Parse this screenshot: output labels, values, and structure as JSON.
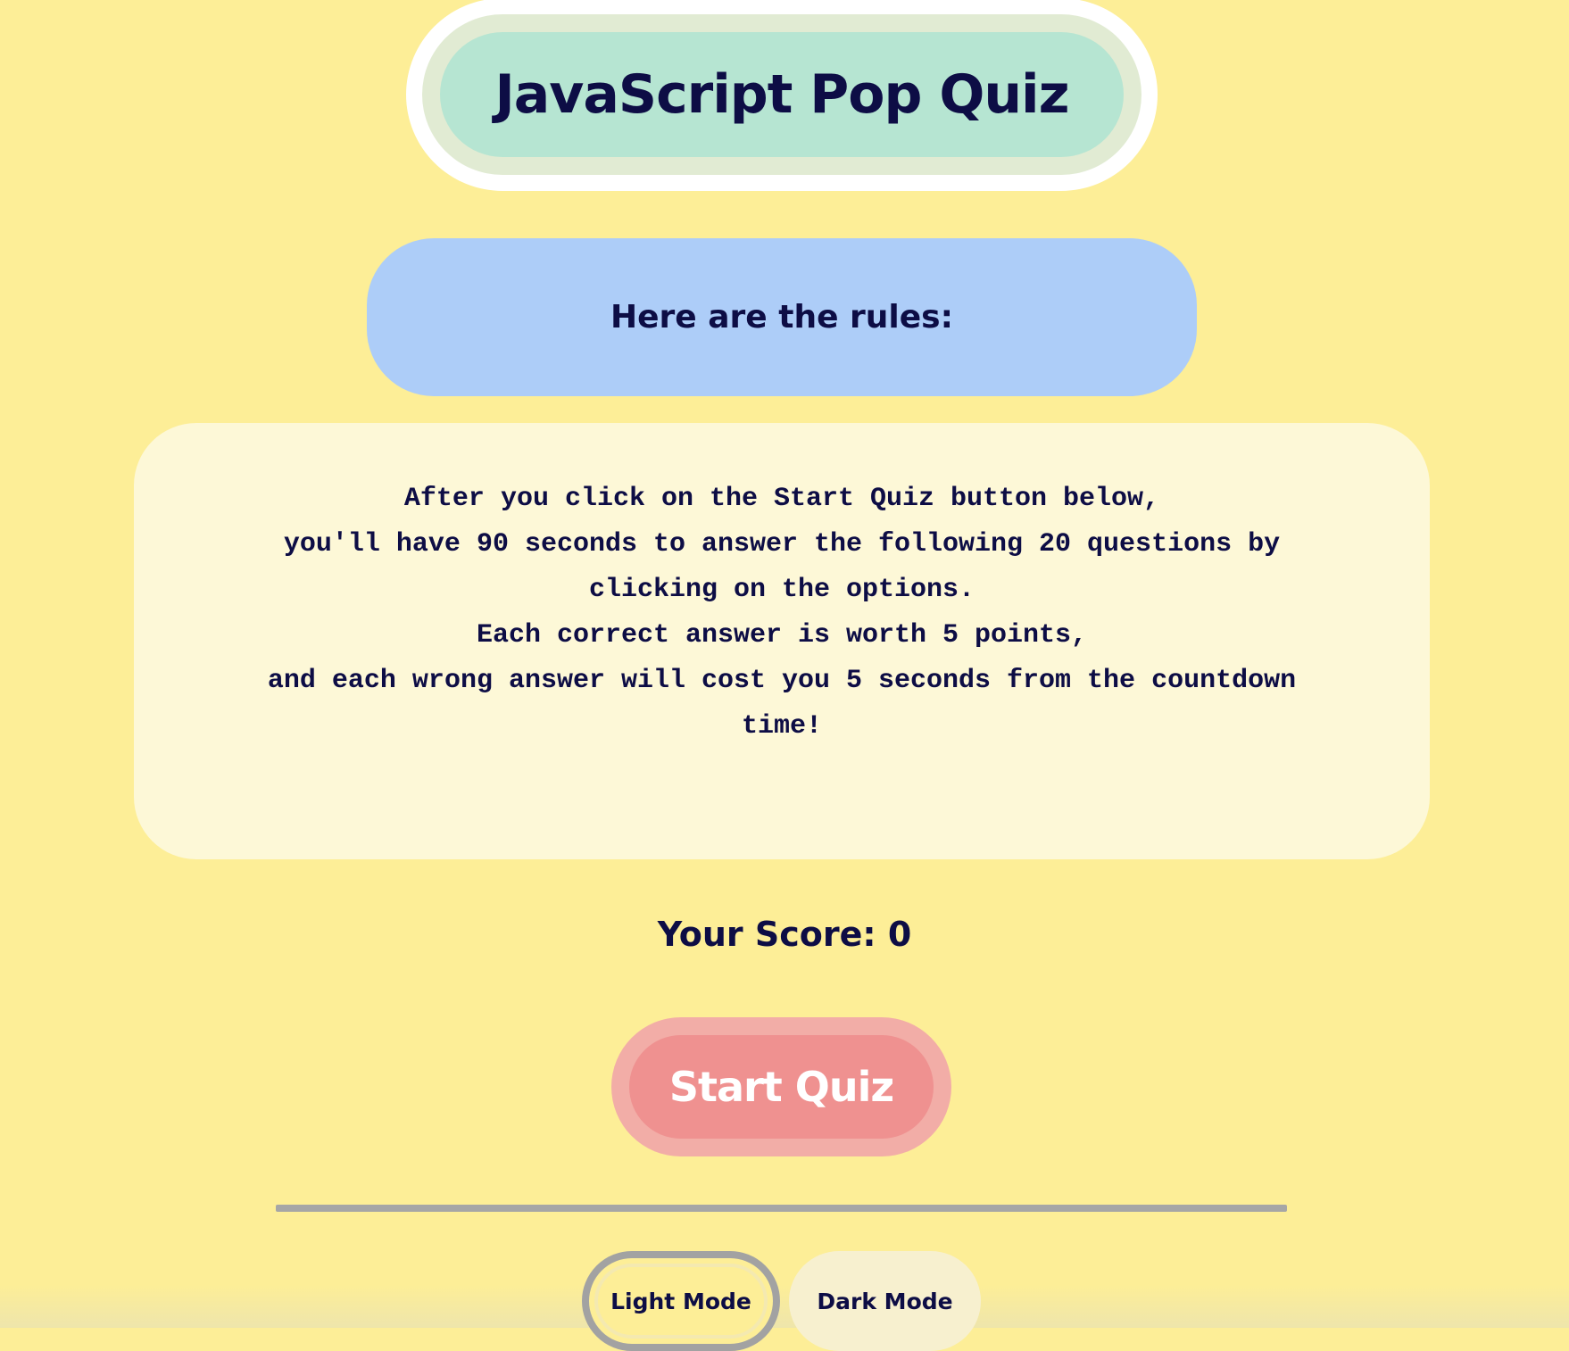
{
  "header": {
    "title": "JavaScript Pop Quiz"
  },
  "rules": {
    "heading": "Here are the rules:",
    "lines": [
      "After you click on the Start Quiz button below,",
      "you'll have 90 seconds to answer the following 20 questions by",
      "clicking on the options.",
      "Each correct answer is worth 5 points,",
      "and each wrong answer will cost you 5 seconds from the countdown",
      "time!"
    ]
  },
  "score": {
    "label": "Your Score: 0"
  },
  "actions": {
    "start_label": "Start Quiz"
  },
  "theme_toggle": {
    "light_label": "Light Mode",
    "dark_label": "Dark Mode",
    "selected": "Light Mode"
  },
  "colors": {
    "page_background": "#fdee97",
    "title_background": "#b6e5d2",
    "rules_heading_background": "#adcdf8",
    "rules_box_background": "#fdf8d7",
    "start_button": "#ef9190",
    "text": "#0d0d45"
  }
}
